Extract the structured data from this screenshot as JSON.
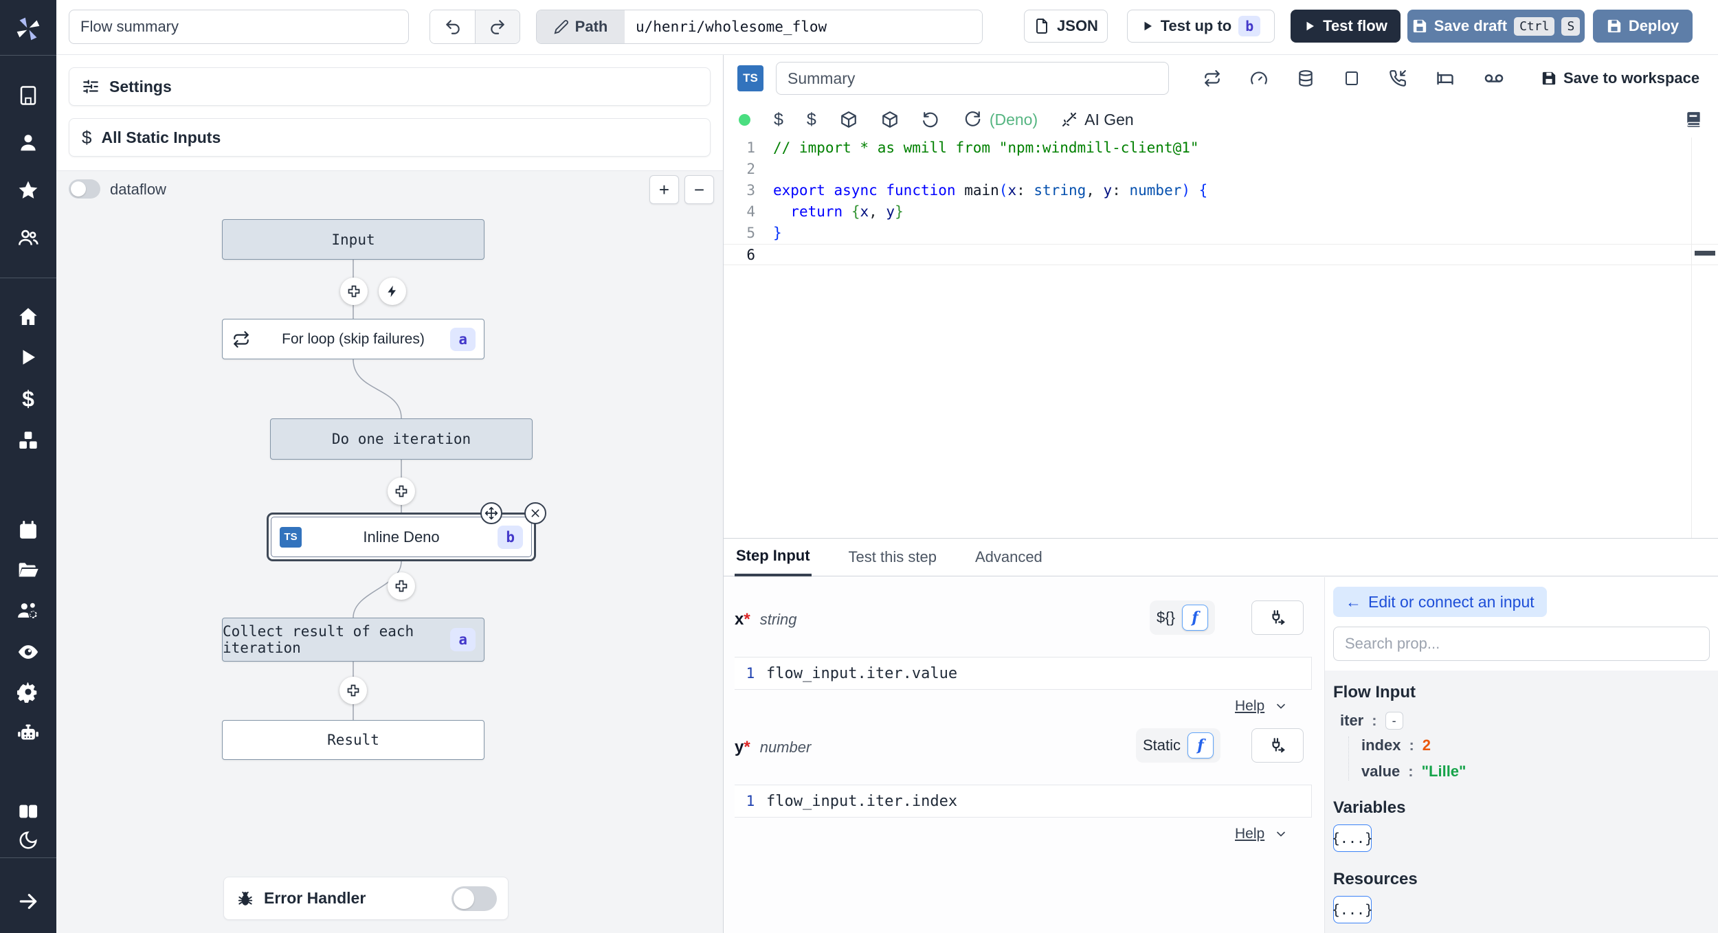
{
  "topbar": {
    "flow_summary_placeholder": "Flow summary",
    "path_label": "Path",
    "path_value": "u/henri/wholesome_flow",
    "json_label": "JSON",
    "test_up_to_label": "Test up to",
    "test_up_to_badge": "b",
    "test_flow_label": "Test flow",
    "save_draft_label": "Save draft",
    "save_draft_kbd1": "Ctrl",
    "save_draft_kbd2": "S",
    "deploy_label": "Deploy"
  },
  "left_panel": {
    "settings_label": "Settings",
    "static_inputs_label": "All Static Inputs",
    "dataflow_label": "dataflow",
    "zoom_in_label": "+",
    "zoom_out_label": "−"
  },
  "graph": {
    "input_label": "Input",
    "for_loop_label": "For loop (skip failures)",
    "for_loop_badge": "a",
    "do_one_label": "Do one iteration",
    "inline_label": "Inline Deno",
    "inline_badge": "b",
    "inline_lang": "TS",
    "collect_label": "Collect result of each iteration",
    "collect_badge": "a",
    "result_label": "Result",
    "error_handler_label": "Error Handler"
  },
  "editor": {
    "lang_badge": "TS",
    "summary_placeholder": "Summary",
    "save_to_workspace_label": "Save to workspace",
    "dollar_1": "$",
    "dollar_2": "$",
    "runtime_label": "(Deno)",
    "ai_gen_label": "AI Gen",
    "code": {
      "lines": [
        {
          "n": "1",
          "tokens": [
            {
              "c": "cmt",
              "t": "// import * as wmill from \"npm:windmill-client@1\""
            }
          ]
        },
        {
          "n": "2",
          "tokens": []
        },
        {
          "n": "3",
          "tokens": [
            {
              "c": "kw",
              "t": "export"
            },
            {
              "c": "pl",
              "t": " "
            },
            {
              "c": "kw",
              "t": "async"
            },
            {
              "c": "pl",
              "t": " "
            },
            {
              "c": "kw",
              "t": "function"
            },
            {
              "c": "pl",
              "t": " "
            },
            {
              "c": "fn",
              "t": "main"
            },
            {
              "c": "b1",
              "t": "("
            },
            {
              "c": "vr",
              "t": "x"
            },
            {
              "c": "pl",
              "t": ": "
            },
            {
              "c": "ty",
              "t": "string"
            },
            {
              "c": "pl",
              "t": ", "
            },
            {
              "c": "vr",
              "t": "y"
            },
            {
              "c": "pl",
              "t": ": "
            },
            {
              "c": "ty",
              "t": "number"
            },
            {
              "c": "b1",
              "t": ")"
            },
            {
              "c": "pl",
              "t": " "
            },
            {
              "c": "b1",
              "t": "{"
            }
          ]
        },
        {
          "n": "4",
          "tokens": [
            {
              "c": "pl",
              "t": "  "
            },
            {
              "c": "kw",
              "t": "return"
            },
            {
              "c": "pl",
              "t": " "
            },
            {
              "c": "b2",
              "t": "{"
            },
            {
              "c": "vr",
              "t": "x"
            },
            {
              "c": "pl",
              "t": ", "
            },
            {
              "c": "vr",
              "t": "y"
            },
            {
              "c": "b2",
              "t": "}"
            }
          ]
        },
        {
          "n": "5",
          "tokens": [
            {
              "c": "b1",
              "t": "}"
            }
          ]
        },
        {
          "n": "6",
          "active": true,
          "tokens": []
        }
      ]
    }
  },
  "step": {
    "tabs": {
      "step_input": "Step Input",
      "test_this_step": "Test this step",
      "advanced": "Advanced"
    },
    "field_x": {
      "name": "x",
      "required": "*",
      "type": "string",
      "mode": "${}",
      "line_no": "1",
      "expr": "flow_input.iter.value",
      "help": "Help"
    },
    "field_y": {
      "name": "y",
      "required": "*",
      "type": "number",
      "mode": "Static",
      "line_no": "1",
      "expr": "flow_input.iter.index",
      "help": "Help"
    }
  },
  "props": {
    "edit_connect_label": "Edit or connect an input",
    "back_arrow": "←",
    "search_placeholder": "Search prop...",
    "flow_input_title": "Flow Input",
    "iter_key": "iter",
    "colon": ":",
    "collapse_label": "-",
    "index_key": "index",
    "index_value": "2",
    "value_key": "value",
    "value_value": "\"Lille\"",
    "variables_title": "Variables",
    "variables_button": "{...}",
    "resources_title": "Resources",
    "resources_button": "{...}"
  },
  "colors": {
    "accent_blue": "#3b82f6",
    "sidebar_bg": "#212938",
    "node_gray": "#dbe2ea",
    "badge_indigo_bg": "#e0e7ff",
    "badge_indigo_fg": "#4338ca",
    "save_btn_blue": "#5e7ea8",
    "deno_green": "#55b581",
    "status_green": "#4ade80"
  }
}
